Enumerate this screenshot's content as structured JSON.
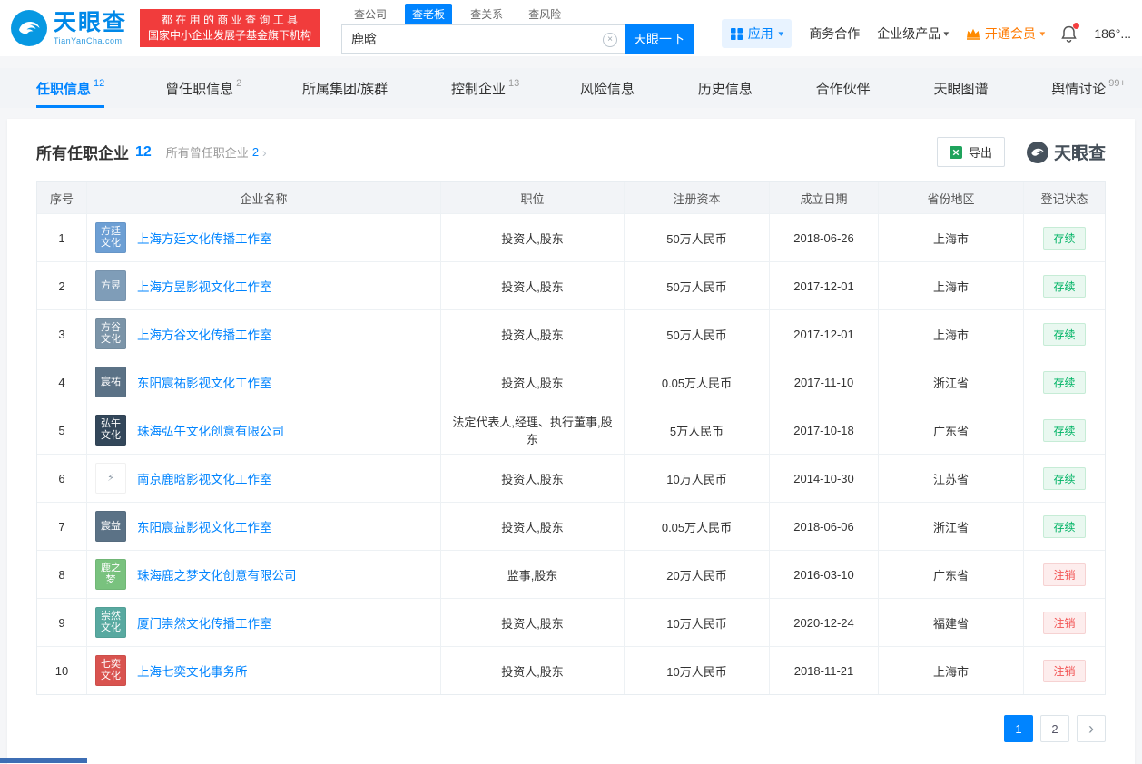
{
  "colors": {
    "brand_blue": "#0084ff",
    "banner_red": "#f13c3c",
    "vip_orange": "#ff7a00",
    "status_active_green": "#00b365",
    "status_cancelled_red": "#f25555"
  },
  "icons": {
    "caret_down": "▾",
    "clear": "×",
    "chevron_right": "›"
  },
  "header": {
    "logo_title": "天眼查",
    "logo_domain": "TianYanCha.com",
    "banner_line1": "都 在 用 的 商 业 查 询 工 具",
    "banner_line2": "国家中小企业发展子基金旗下机构",
    "search_tabs": [
      {
        "label": "查公司",
        "cls": ""
      },
      {
        "label": "查老板",
        "cls": "active"
      },
      {
        "label": "查关系",
        "cls": ""
      },
      {
        "label": "查风险",
        "cls": ""
      }
    ],
    "search_value": "鹿晗",
    "search_button": "天眼一下",
    "apps_label": "应用",
    "link_cooperation": "商务合作",
    "link_products": "企业级产品",
    "vip_label": "开通会员",
    "phone": "186°..."
  },
  "nav_tabs": [
    {
      "label": "任职信息",
      "count": "12",
      "cls": "active"
    },
    {
      "label": "曾任职信息",
      "count": "2",
      "cls": ""
    },
    {
      "label": "所属集团/族群",
      "count": "",
      "cls": ""
    },
    {
      "label": "控制企业",
      "count": "13",
      "cls": ""
    },
    {
      "label": "风险信息",
      "count": "",
      "cls": ""
    },
    {
      "label": "历史信息",
      "count": "",
      "cls": ""
    },
    {
      "label": "合作伙伴",
      "count": "",
      "cls": ""
    },
    {
      "label": "天眼图谱",
      "count": "",
      "cls": ""
    },
    {
      "label": "舆情讨论",
      "count": "99+",
      "cls": ""
    }
  ],
  "main": {
    "title": "所有任职企业",
    "title_count": "12",
    "sub_title": "所有曾任职企业",
    "sub_count": "2",
    "export_label": "导出",
    "watermark": "天眼查",
    "table_headers": [
      "序号",
      "企业名称",
      "职位",
      "注册资本",
      "成立日期",
      "省份地区",
      "登记状态"
    ],
    "rows": [
      {
        "no": "1",
        "logo": {
          "text": "方廷文化",
          "bg": "#6d9fd4",
          "fg": "#ffffff"
        },
        "name": "上海方廷文化传播工作室",
        "position": "投资人,股东",
        "capital": "50万人民币",
        "date": "2018-06-26",
        "province": "上海市",
        "status": "存续",
        "status_cls": "ok"
      },
      {
        "no": "2",
        "logo": {
          "text": "方昱",
          "bg": "#7f9db8",
          "fg": "#ffffff"
        },
        "name": "上海方昱影视文化工作室",
        "position": "投资人,股东",
        "capital": "50万人民币",
        "date": "2017-12-01",
        "province": "上海市",
        "status": "存续",
        "status_cls": "ok"
      },
      {
        "no": "3",
        "logo": {
          "text": "方谷文化",
          "bg": "#7b94a8",
          "fg": "#ffffff"
        },
        "name": "上海方谷文化传播工作室",
        "position": "投资人,股东",
        "capital": "50万人民币",
        "date": "2017-12-01",
        "province": "上海市",
        "status": "存续",
        "status_cls": "ok"
      },
      {
        "no": "4",
        "logo": {
          "text": "宸祐",
          "bg": "#5b7286",
          "fg": "#ffffff"
        },
        "name": "东阳宸祐影视文化工作室",
        "position": "投资人,股东",
        "capital": "0.05万人民币",
        "date": "2017-11-10",
        "province": "浙江省",
        "status": "存续",
        "status_cls": "ok"
      },
      {
        "no": "5",
        "logo": {
          "text": "弘午文化",
          "bg": "#33475a",
          "fg": "#ffffff"
        },
        "name": "珠海弘午文化创意有限公司",
        "position": "法定代表人,经理、执行董事,股东",
        "capital": "5万人民币",
        "date": "2017-10-18",
        "province": "广东省",
        "status": "存续",
        "status_cls": "ok"
      },
      {
        "no": "6",
        "logo": {
          "text": "⚡",
          "bg": "#ffffff",
          "fg": "#8b98a5"
        },
        "name": "南京鹿晗影视文化工作室",
        "position": "投资人,股东",
        "capital": "10万人民币",
        "date": "2014-10-30",
        "province": "江苏省",
        "status": "存续",
        "status_cls": "ok"
      },
      {
        "no": "7",
        "logo": {
          "text": "宸益",
          "bg": "#5b7286",
          "fg": "#ffffff"
        },
        "name": "东阳宸益影视文化工作室",
        "position": "投资人,股东",
        "capital": "0.05万人民币",
        "date": "2018-06-06",
        "province": "浙江省",
        "status": "存续",
        "status_cls": "ok"
      },
      {
        "no": "8",
        "logo": {
          "text": "鹿之梦",
          "bg": "#79c27e",
          "fg": "#ffffff"
        },
        "name": "珠海鹿之梦文化创意有限公司",
        "position": "监事,股东",
        "capital": "20万人民币",
        "date": "2016-03-10",
        "province": "广东省",
        "status": "注销",
        "status_cls": "off"
      },
      {
        "no": "9",
        "logo": {
          "text": "崇然文化",
          "bg": "#58a9a0",
          "fg": "#ffffff"
        },
        "name": "厦门崇然文化传播工作室",
        "position": "投资人,股东",
        "capital": "10万人民币",
        "date": "2020-12-24",
        "province": "福建省",
        "status": "注销",
        "status_cls": "off"
      },
      {
        "no": "10",
        "logo": {
          "text": "七奕文化",
          "bg": "#d9534f",
          "fg": "#ffffff"
        },
        "name": "上海七奕文化事务所",
        "position": "投资人,股东",
        "capital": "10万人民币",
        "date": "2018-11-21",
        "province": "上海市",
        "status": "注销",
        "status_cls": "off"
      }
    ],
    "pagination": {
      "pages": [
        {
          "label": "1",
          "cls": "current"
        },
        {
          "label": "2",
          "cls": ""
        }
      ]
    }
  }
}
